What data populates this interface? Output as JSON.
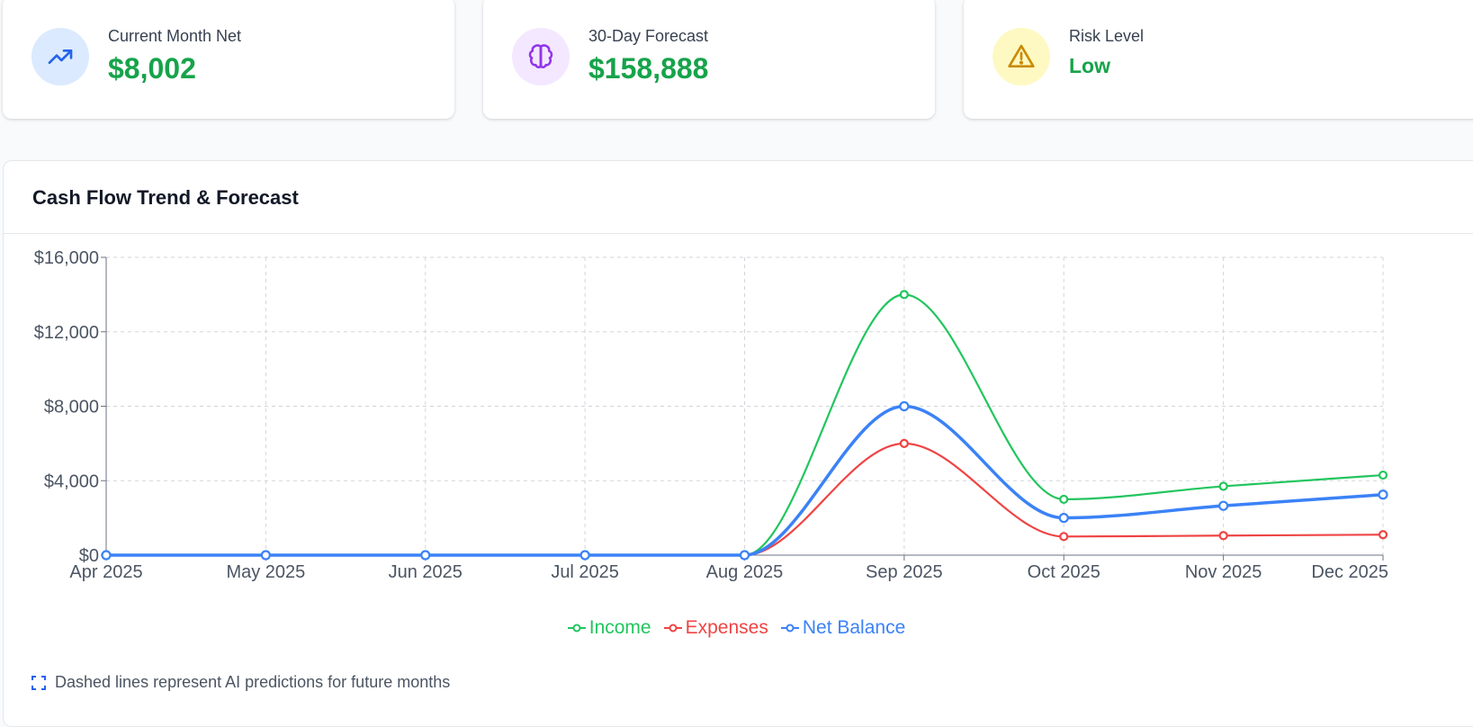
{
  "stats": [
    {
      "label": "Current Month Net",
      "value": "$8,002",
      "icon": "trending-up-icon",
      "icon_color": "#2563eb",
      "icon_bg": "#dbeafe"
    },
    {
      "label": "30-Day Forecast",
      "value": "$158,888",
      "icon": "brain-icon",
      "icon_color": "#9333ea",
      "icon_bg": "#f3e8ff"
    },
    {
      "label": "Risk Level",
      "value": "Low",
      "icon": "warning-icon",
      "icon_color": "#ca8a04",
      "icon_bg": "#fef9c3"
    }
  ],
  "panel": {
    "title": "Cash Flow Trend & Forecast",
    "footnote": "Dashed lines represent AI predictions for future months",
    "footnote_icon": "dashed-square-icon"
  },
  "chart_data": {
    "type": "line",
    "categories": [
      "Apr 2025",
      "May 2025",
      "Jun 2025",
      "Jul 2025",
      "Aug 2025",
      "Sep 2025",
      "Oct 2025",
      "Nov 2025",
      "Dec 2025"
    ],
    "y_ticks": [
      "$0",
      "$4,000",
      "$8,000",
      "$12,000",
      "$16,000"
    ],
    "ylim": [
      0,
      16000
    ],
    "grid": true,
    "legend_position": "bottom-center",
    "series": [
      {
        "name": "Income",
        "color": "#22c55e",
        "values": [
          0,
          0,
          0,
          0,
          0,
          14000,
          3000,
          3700,
          4300
        ]
      },
      {
        "name": "Expenses",
        "color": "#ef4444",
        "values": [
          0,
          0,
          0,
          0,
          0,
          6000,
          1000,
          1050,
          1100
        ]
      },
      {
        "name": "Net Balance",
        "color": "#3b82f6",
        "values": [
          0,
          0,
          0,
          0,
          0,
          8000,
          2000,
          2650,
          3250
        ]
      }
    ]
  }
}
